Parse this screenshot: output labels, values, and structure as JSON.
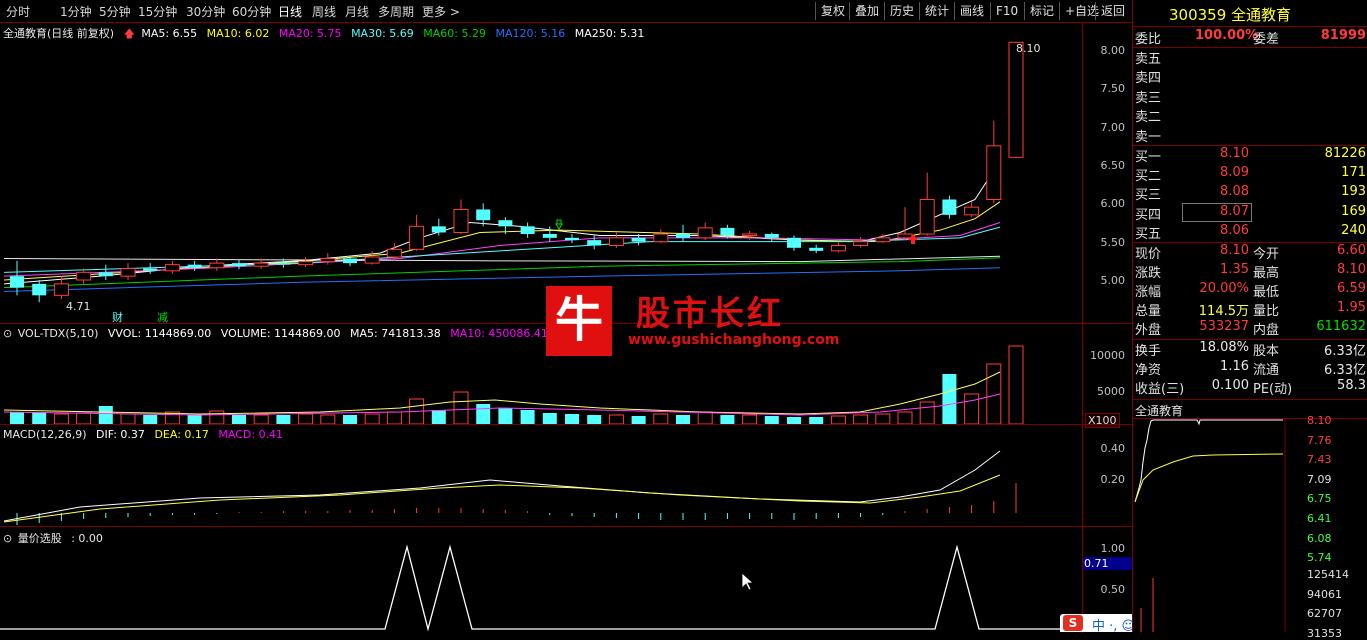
{
  "toolbar": {
    "periods": [
      "分时",
      "1分钟",
      "5分钟",
      "15分钟",
      "30分钟",
      "60分钟",
      "日线",
      "周线",
      "月线",
      "多周期",
      "更多 >"
    ],
    "buttons": [
      "复权",
      "叠加",
      "历史",
      "统计",
      "画线",
      "F10",
      "标记",
      "+自选",
      "返回"
    ]
  },
  "main_legend": {
    "title": "全通教育(日线 前复权)",
    "items": [
      {
        "label": "MA5: 6.55",
        "color": "#ffffff"
      },
      {
        "label": "MA10: 6.02",
        "color": "#ffff00"
      },
      {
        "label": "MA20: 5.75",
        "color": "#ff00ff"
      },
      {
        "label": "MA30: 5.69",
        "color": "#00c000"
      },
      {
        "label": "MA60: 5.29",
        "color": "#00c000"
      },
      {
        "label": "MA120: 5.16",
        "color": "#0080ff"
      },
      {
        "label": "MA250: 5.31",
        "color": "#ffffff"
      }
    ],
    "high_label": "8.10",
    "low_label": "4.71",
    "marker_cai": "财",
    "marker_jian": "减"
  },
  "price_axis": [
    "8.00",
    "7.50",
    "7.00",
    "6.50",
    "6.00",
    "5.50",
    "5.00"
  ],
  "vol_legend": {
    "title": "VOL-TDX(5,10)",
    "items": [
      {
        "label": "VVOL: 1144869.00",
        "color": "#ffffff"
      },
      {
        "label": "VOLUME: 1144869.00",
        "color": "#ffffff"
      },
      {
        "label": "MA5: 741813.38",
        "color": "#ffffff"
      },
      {
        "label": "MA10: 450086.41",
        "color": "#ff00ff"
      }
    ]
  },
  "vol_axis": [
    "10000",
    "5000"
  ],
  "vol_unit": "X100",
  "macd_legend": {
    "title": "MACD(12,26,9)",
    "items": [
      {
        "label": "DIF: 0.37",
        "color": "#ffffff"
      },
      {
        "label": "DEA: 0.17",
        "color": "#ffff00"
      },
      {
        "label": "MACD: 0.41",
        "color": "#ff00ff"
      }
    ]
  },
  "macd_axis": [
    "0.40",
    "0.20"
  ],
  "xuangu_legend": {
    "title": "量价选股",
    "value": ": 0.00"
  },
  "xuangu_axis": [
    "1.00",
    "0.50"
  ],
  "xuangu_current": "0.71",
  "watermark": {
    "char": "牛",
    "name": "股市长红",
    "url": "www.gushichanghong.com"
  },
  "quote": {
    "code_name": "300359 全通教育",
    "weibi_label": "委比",
    "weibi_value": "100.00%",
    "weicha_label": "委差",
    "weicha_value": "81999",
    "asks": [
      {
        "label": "卖五",
        "price": "",
        "vol": ""
      },
      {
        "label": "卖四",
        "price": "",
        "vol": ""
      },
      {
        "label": "卖三",
        "price": "",
        "vol": ""
      },
      {
        "label": "卖二",
        "price": "",
        "vol": ""
      },
      {
        "label": "卖一",
        "price": "",
        "vol": ""
      }
    ],
    "bids": [
      {
        "label": "买一",
        "price": "8.10",
        "vol": "81226"
      },
      {
        "label": "买二",
        "price": "8.09",
        "vol": "171"
      },
      {
        "label": "买三",
        "price": "8.08",
        "vol": "193"
      },
      {
        "label": "买四",
        "price": "8.07",
        "vol": "169"
      },
      {
        "label": "买五",
        "price": "8.06",
        "vol": "240"
      }
    ],
    "stats": [
      {
        "l1": "现价",
        "v1": "8.10",
        "c1": "red",
        "l2": "今开",
        "v2": "6.60",
        "c2": "red"
      },
      {
        "l1": "涨跌",
        "v1": "1.35",
        "c1": "red",
        "l2": "最高",
        "v2": "8.10",
        "c2": "red"
      },
      {
        "l1": "涨幅",
        "v1": "20.00%",
        "c1": "red",
        "l2": "最低",
        "v2": "6.59",
        "c2": "red"
      },
      {
        "l1": "总量",
        "v1": "114.5万",
        "c1": "yel",
        "l2": "量比",
        "v2": "1.95",
        "c2": "red"
      },
      {
        "l1": "外盘",
        "v1": "533237",
        "c1": "red",
        "l2": "内盘",
        "v2": "611632",
        "c2": "grn"
      }
    ],
    "stats2": [
      {
        "l1": "换手",
        "v1": "18.08%",
        "l2": "股本",
        "v2": "6.33亿"
      },
      {
        "l1": "净资",
        "v1": "1.16",
        "l2": "流通",
        "v2": "6.33亿"
      },
      {
        "l1": "收益(三)",
        "v1": "0.100",
        "l2": "PE(动)",
        "v2": "58.3"
      }
    ],
    "mini_title": "全通教育",
    "mini_axis": [
      "8.10",
      "7.76",
      "7.43",
      "7.09",
      "6.75",
      "6.41",
      "6.08",
      "5.74"
    ],
    "mini_vol_axis": [
      "125414",
      "94061",
      "62707",
      "31353"
    ]
  },
  "colors": {
    "up": "#ff3b3b",
    "down": "#54ffff",
    "border": "#7a0000"
  }
}
